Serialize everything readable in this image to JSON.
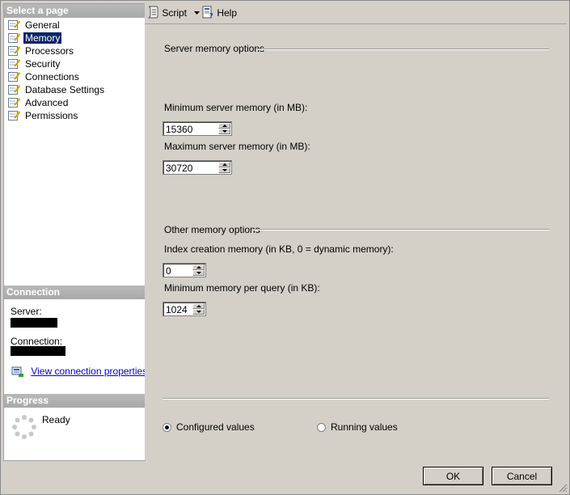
{
  "left_pane": {
    "select_page_header": "Select a page",
    "pages": [
      {
        "label": "General"
      },
      {
        "label": "Memory"
      },
      {
        "label": "Processors"
      },
      {
        "label": "Security"
      },
      {
        "label": "Connections"
      },
      {
        "label": "Database Settings"
      },
      {
        "label": "Advanced"
      },
      {
        "label": "Permissions"
      }
    ],
    "selected_page": "Memory",
    "connection_header": "Connection",
    "server_label": "Server:",
    "connection_label": "Connection:",
    "view_connection_properties": "View connection properties",
    "progress_header": "Progress",
    "progress_status": "Ready"
  },
  "toolbar": {
    "script_label": "Script",
    "help_label": "Help"
  },
  "memory": {
    "server_group_title": "Server memory options",
    "min_server_memory_label": "Minimum server memory (in MB):",
    "min_server_memory_value": "15360",
    "max_server_memory_label": "Maximum server memory (in MB):",
    "max_server_memory_value": "30720",
    "other_group_title": "Other memory options",
    "index_creation_label": "Index creation memory (in KB, 0 = dynamic memory):",
    "index_creation_value": "0",
    "min_query_label": "Minimum memory per query (in KB):",
    "min_query_value": "1024"
  },
  "values_mode": {
    "configured_label": "Configured values",
    "running_label": "Running values",
    "selected": "configured"
  },
  "buttons": {
    "ok_label": "OK",
    "cancel_label": "Cancel"
  },
  "colors": {
    "selection": "#0a246a",
    "link": "#0000cc",
    "section_header": "#ababab"
  }
}
